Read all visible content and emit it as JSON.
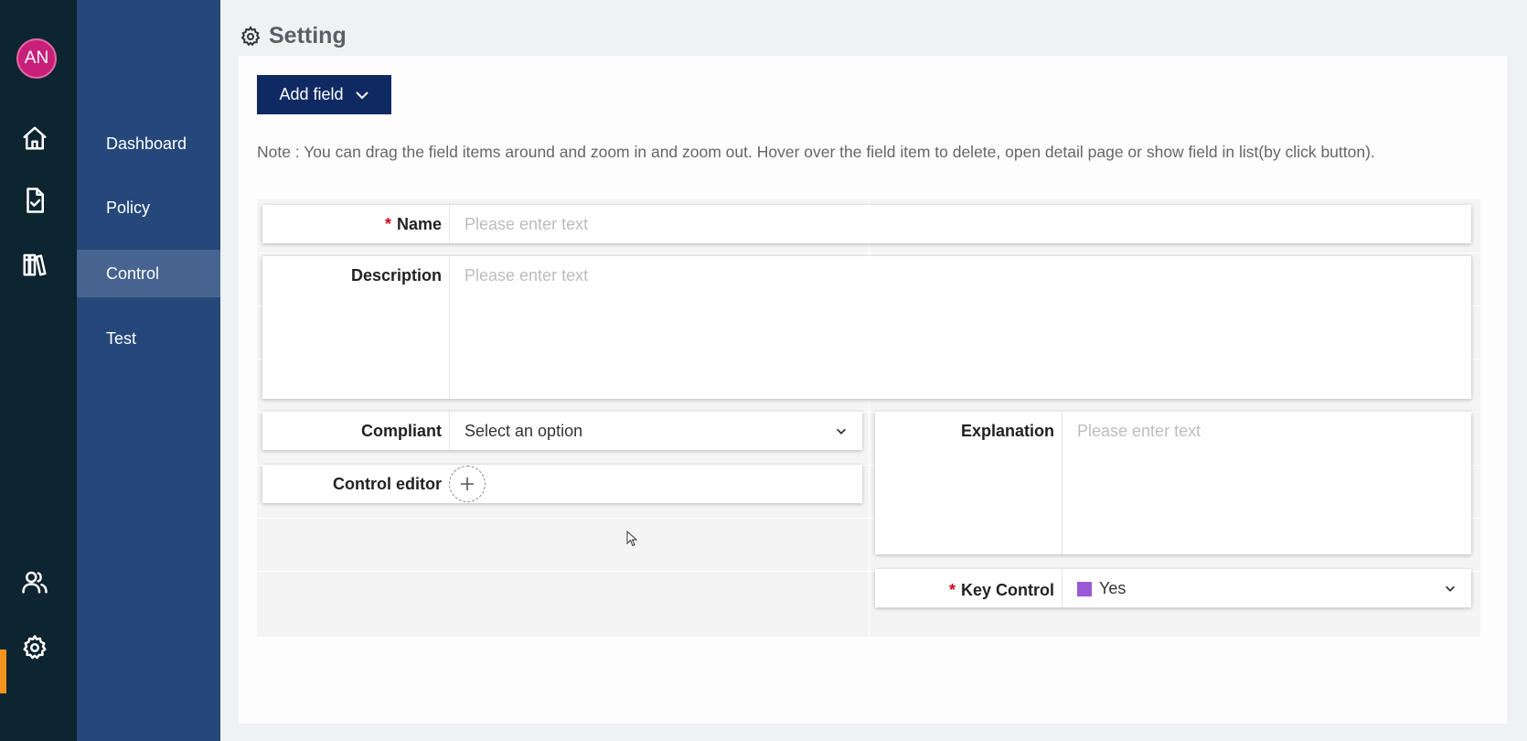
{
  "user": {
    "initials": "AN"
  },
  "rail": {
    "icons": [
      "home-icon",
      "document-check-icon",
      "library-icon",
      "users-icon",
      "gear-icon"
    ],
    "active_color": "#f7941d"
  },
  "sidebar": {
    "items": [
      {
        "label": "Dashboard",
        "active": false
      },
      {
        "label": "Policy",
        "active": false
      },
      {
        "label": "Control",
        "active": true
      },
      {
        "label": "Test",
        "active": false
      }
    ]
  },
  "page": {
    "title": "Setting"
  },
  "toolbar": {
    "add_field_label": "Add field"
  },
  "note": "Note : You can drag the field items around and zoom in and zoom out. Hover over the field item to delete, open detail page or show field in list(by click button).",
  "fields": {
    "name": {
      "label": "Name",
      "required": "*",
      "placeholder": "Please enter text"
    },
    "description": {
      "label": "Description",
      "placeholder": "Please enter text"
    },
    "compliant": {
      "label": "Compliant",
      "value": "Select an option"
    },
    "control_editor": {
      "label": "Control editor"
    },
    "explanation": {
      "label": "Explanation",
      "placeholder": "Please enter text"
    },
    "key_control": {
      "label": "Key Control",
      "required": "*",
      "value": "Yes",
      "swatch_color": "#9b59d6"
    }
  },
  "colors": {
    "rail_bg": "#0d2530",
    "sidebar_bg": "#25477a",
    "sidebar_active_bg": "#46648f",
    "button_bg": "#0f2a63",
    "required": "#d0021b",
    "avatar_bg": "#c8207a"
  }
}
